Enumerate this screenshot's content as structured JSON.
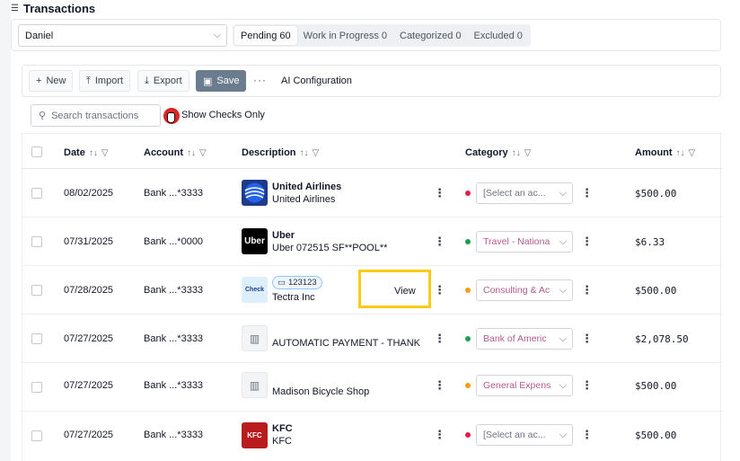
{
  "page": {
    "title": "Transactions",
    "title_icon": "list-icon"
  },
  "filters": {
    "account_select": "Daniel",
    "tabs": [
      {
        "label": "Pending 60",
        "active": true
      },
      {
        "label": "Work in Progress 0",
        "active": false
      },
      {
        "label": "Categorized 0",
        "active": false
      },
      {
        "label": "Excluded 0",
        "active": false
      }
    ]
  },
  "toolbar": {
    "new_label": "New",
    "import_label": "Import",
    "export_label": "Export",
    "save_label": "Save",
    "more_label": "···",
    "ai_config_label": "AI Configuration"
  },
  "search": {
    "placeholder": "Search transactions",
    "show_checks_label": "Show Checks Only"
  },
  "table": {
    "headers": {
      "date": "Date",
      "account": "Account",
      "description": "Description",
      "category": "Category",
      "amount": "Amount"
    },
    "rows": [
      {
        "date": "08/02/2025",
        "account": "Bank ...*3333",
        "title": "United Airlines",
        "sub": "United Airlines",
        "logo": "united-airlines-logo",
        "category": "[Select an ac...",
        "category_color": "#e11d48",
        "category_text_color": "#6b7280",
        "amount": "$500.00"
      },
      {
        "date": "07/31/2025",
        "account": "Bank ...*0000",
        "title": "Uber",
        "sub": "Uber 072515 SF**POOL**",
        "logo": "uber-logo",
        "logo_text": "Uber",
        "category": "Travel - Nationa",
        "category_color": "#16a34a",
        "category_text_color": "#b45a8c",
        "amount": "$6.33"
      },
      {
        "date": "07/28/2025",
        "account": "Bank ...*3333",
        "check_number": "123123",
        "sub": "Tectra Inc",
        "logo": "check-logo",
        "logo_text": "Check",
        "view_label": "View",
        "category": "Consulting & Ac",
        "category_color": "#f59e0b",
        "category_text_color": "#b45a8c",
        "amount": "$500.00"
      },
      {
        "date": "07/27/2025",
        "account": "Bank ...*3333",
        "sub": "AUTOMATIC PAYMENT - THANK",
        "logo": "bank-building-icon",
        "category": "Bank of Americ",
        "category_color": "#16a34a",
        "category_text_color": "#b45a8c",
        "amount": "$2,078.50"
      },
      {
        "date": "07/27/2025",
        "account": "Bank ...*3333",
        "sub": "Madison Bicycle Shop",
        "logo": "bank-building-icon",
        "category": "General Expens",
        "category_color": "#f59e0b",
        "category_text_color": "#b45a8c",
        "amount": "$500.00"
      },
      {
        "date": "07/27/2025",
        "account": "Bank ...*3333",
        "title": "KFC",
        "sub": "KFC",
        "logo": "kfc-logo",
        "logo_text": "KFC",
        "category": "[Select an ac...",
        "category_color": "#e11d48",
        "category_text_color": "#6b7280",
        "amount": "$500.00"
      }
    ]
  }
}
